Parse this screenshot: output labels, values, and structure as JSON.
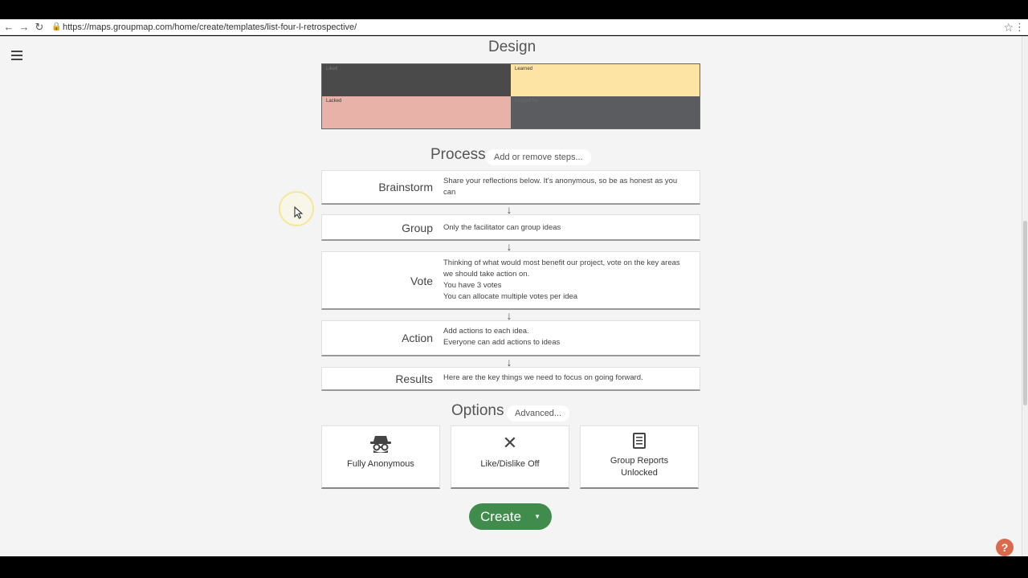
{
  "browser": {
    "url": "https://maps.groupmap.com/home/create/templates/list-four-l-retrospective/",
    "back_icon": "back-arrow-icon",
    "forward_icon": "forward-arrow-icon",
    "reload_icon": "reload-icon"
  },
  "design": {
    "title": "Design",
    "cells": [
      {
        "label": "Liked",
        "color": "#4a4a4a"
      },
      {
        "label": "Learned",
        "color": "#fde3a4"
      },
      {
        "label": "Lacked",
        "color": "#e8b2a8"
      },
      {
        "label": "Longed for",
        "color": "#5a5c60"
      }
    ]
  },
  "process": {
    "title": "Process",
    "add_remove_label": "Add or remove steps...",
    "steps": [
      {
        "name": "Brainstorm",
        "desc": [
          "Share your reflections below. It's anonymous, so be as honest as you can"
        ]
      },
      {
        "name": "Group",
        "desc": [
          "Only the facilitator can group ideas"
        ]
      },
      {
        "name": "Vote",
        "desc": [
          "Thinking of what would most benefit our project, vote on the key areas we should take action on.",
          "You have 3 votes",
          "You can allocate multiple votes per idea"
        ]
      },
      {
        "name": "Action",
        "desc": [
          "Add actions to each idea.",
          "Everyone can add actions to ideas"
        ]
      },
      {
        "name": "Results",
        "desc": [
          "Here are the key things we need to focus on going forward."
        ]
      }
    ]
  },
  "options": {
    "title": "Options",
    "advanced_label": "Advanced...",
    "cards": [
      {
        "label": "Fully Anonymous",
        "icon": "spy-icon"
      },
      {
        "label": "Like/Dislike Off",
        "icon": "cross-icon"
      },
      {
        "label_line1": "Group Reports",
        "label_line2": "Unlocked",
        "icon": "document-icon"
      }
    ]
  },
  "create": {
    "label": "Create"
  },
  "help": {
    "label": "?"
  },
  "colors": {
    "accent_green": "#3f8c4c",
    "help_orange": "#d96b4c"
  }
}
